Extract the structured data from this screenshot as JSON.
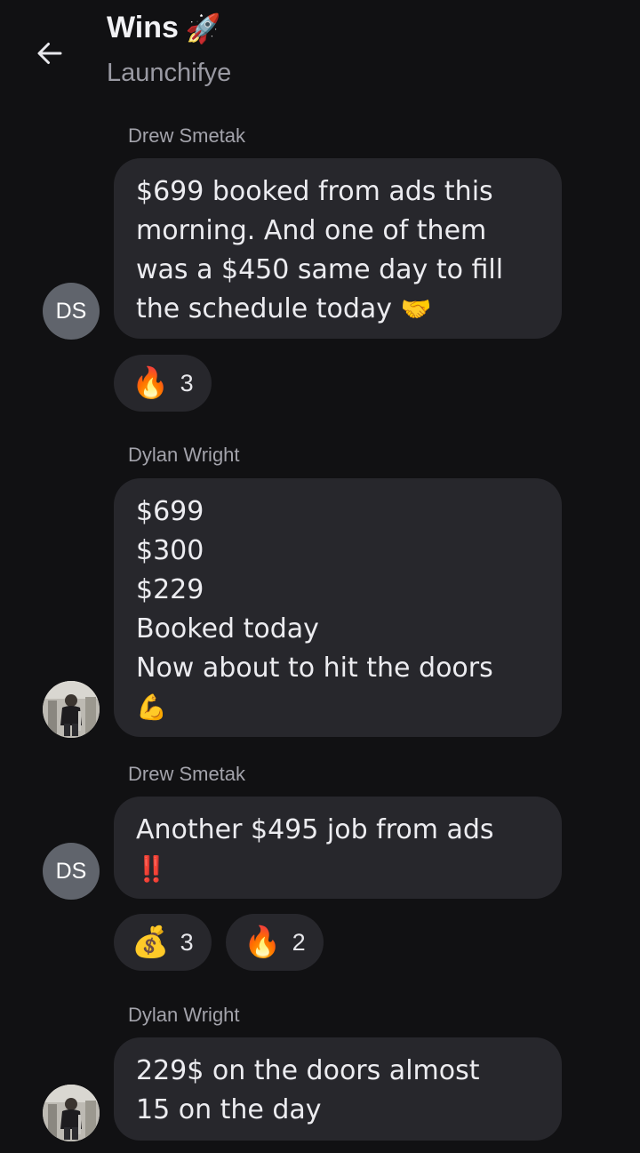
{
  "header": {
    "title": "Wins",
    "title_emoji": "🚀",
    "subtitle": "Launchifye",
    "back_icon": "arrow-left-icon"
  },
  "messages": [
    {
      "sender": "Drew Smetak",
      "avatar_initials": "DS",
      "text": "$699 booked from ads this morning. And one of them was a $450 same day to fill the schedule today",
      "emoji": "🤝",
      "reactions": [
        {
          "emoji": "🔥",
          "count": "3"
        }
      ]
    },
    {
      "sender": "Dylan Wright",
      "avatar_initials": "",
      "text": "$699\n$300\n $229\nBooked today\nNow about to hit the doors",
      "emoji": "💪",
      "reactions": []
    },
    {
      "sender": "Drew Smetak",
      "avatar_initials": "DS",
      "text": "Another $495 job from ads",
      "emoji": "‼️",
      "reactions": [
        {
          "emoji": "💰",
          "count": "3"
        },
        {
          "emoji": "🔥",
          "count": "2"
        }
      ]
    },
    {
      "sender": "Dylan Wright",
      "avatar_initials": "",
      "text": "229$ on the doors almost\n15 on the day",
      "emoji": "",
      "reactions": []
    }
  ],
  "colors": {
    "background": "#111113",
    "bubble": "#27272c",
    "avatar_initials_bg": "#60646c"
  }
}
